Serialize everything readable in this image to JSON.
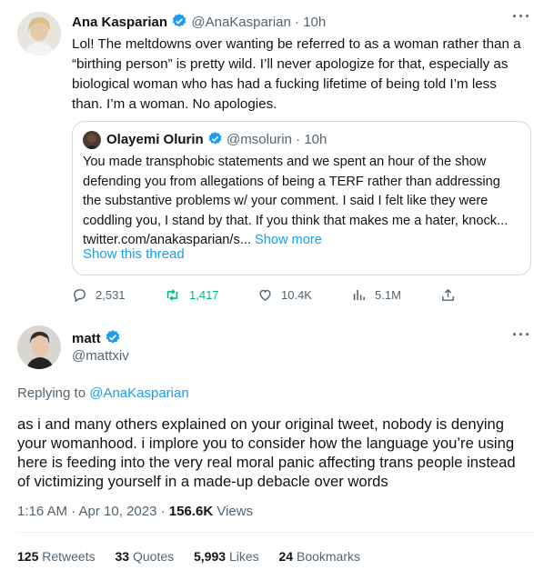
{
  "top_tweet": {
    "author_name": "Ana Kasparian",
    "handle": "@AnaKasparian",
    "time": "10h",
    "text": "Lol! The meltdowns over wanting be referred to as a woman rather than a “birthing person” is pretty wild. I’ll never apologize for that, especially as biological woman who has had a fucking lifetime of being told I’m less than. I’m a woman. No apologies.",
    "quote": {
      "author_name": "Olayemi Olurin",
      "handle": "@msolurin",
      "time": "10h",
      "text": "You made transphobic statements and we spent an hour of the show defending you from allegations of being a TERF rather than addressing the substantive problems w/ your comment. I said I felt like they were coddling you, I stand by that. If you think that makes me a hater, knock... twitter.com/anakasparian/s...",
      "show_more": "Show more"
    },
    "show_thread": "Show this thread",
    "actions": {
      "replies": "2,531",
      "retweets": "1,417",
      "likes": "10.4K",
      "views": "5.1M"
    }
  },
  "main_tweet": {
    "author_name": "matt",
    "handle": "@mattxiv",
    "replying_prefix": "Replying to",
    "replying_handle": "@AnaKasparian",
    "text": "as i and many others explained on your original tweet, nobody is denying your womanhood. i implore you to consider how the language you’re using here is feeding into the very real moral panic affecting trans people instead of victimizing yourself in a made-up debacle over words",
    "time": "1:16 AM · Apr 10, 2023 ·",
    "views_count": "156.6K",
    "views_label": "Views",
    "stats": {
      "retweets_count": "125",
      "retweets_label": "Retweets",
      "quotes_count": "33",
      "quotes_label": "Quotes",
      "likes_count": "5,993",
      "likes_label": "Likes",
      "bookmarks_count": "24",
      "bookmarks_label": "Bookmarks"
    }
  },
  "colors": {
    "accent": "#1d9bf0",
    "retweet_green": "#00ba7c",
    "muted": "#536471",
    "border": "#eff3f4"
  }
}
